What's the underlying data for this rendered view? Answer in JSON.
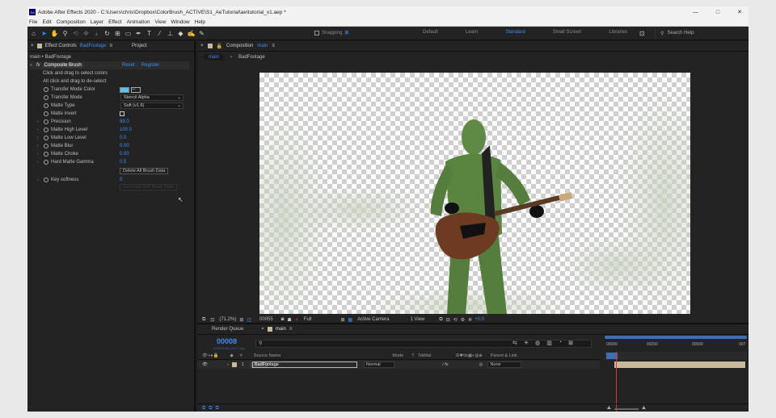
{
  "window": {
    "title": "Adobe After Effects 2020 - C:\\Users\\chris\\Dropbox\\ColorBrush_ACTIVE\\S1_AeTutorial\\ae\\tutorial_v1.aep *",
    "logo": "Ae",
    "minimize": "—",
    "maximize": "□",
    "close": "✕"
  },
  "menu": [
    "File",
    "Edit",
    "Composition",
    "Layer",
    "Effect",
    "Animation",
    "View",
    "Window",
    "Help"
  ],
  "toolbar": {
    "snapping": "Snapping",
    "workspaces": [
      "Default",
      "Learn",
      "Standard",
      "Small Screen",
      "Libraries"
    ],
    "active_workspace": "Standard",
    "search_placeholder": "Search Help"
  },
  "effect_controls": {
    "tab_label": "Effect Controls",
    "tab_layer": "BadFootage",
    "tab_project": "Project",
    "breadcrumb": "main • BadFootage",
    "effect_name": "Composite Brush",
    "reset": "Reset",
    "register": "Register",
    "hint1": "Click and drag to select colors",
    "hint2": "Alt click and drag to de-select",
    "properties": [
      {
        "label": "Transfer Mode Color",
        "value": ""
      },
      {
        "label": "Transfer Mode",
        "value": "Stencil Alpha"
      },
      {
        "label": "Matte Type",
        "value": "Soft (v1.6)"
      },
      {
        "label": "Matte Invert",
        "value": ""
      },
      {
        "label": "Precision",
        "value": "98.0"
      },
      {
        "label": "Matte High Level",
        "value": "100.0"
      },
      {
        "label": "Matte Low Level",
        "value": "0.0"
      },
      {
        "label": "Matte Blur",
        "value": "0.00"
      },
      {
        "label": "Matte Choke",
        "value": "0.00"
      },
      {
        "label": "Hard Matte Gamma",
        "value": "0.5"
      }
    ],
    "delete_button": "Delete All Brush Data",
    "key_softness_label": "Key softness",
    "key_softness_value": "0",
    "dim_button": "Generate Soft Matte Data"
  },
  "composition": {
    "panel_label": "Composition",
    "comp_name": "main",
    "tab": "main",
    "breadcrumb_layer": "BadFootage",
    "zoom": "(71.2%)",
    "timecode": "00055",
    "resolution": "Full",
    "camera": "Active Camera",
    "views": "1 View",
    "exposure": "+0.0"
  },
  "timeline": {
    "render_queue": "Render Queue",
    "comp_tab": "main",
    "timecode": "00008",
    "timecode_sub": "0:00:00:08 (29.97 fps)",
    "columns": {
      "source": "Source Name",
      "mode": "Mode",
      "trkmat": "TrkMat",
      "parent": "Parent & Link"
    },
    "layer": {
      "index": "1",
      "name": "BadFootage",
      "mode": "Normal",
      "parent": "None"
    },
    "ruler": [
      "00000",
      "00250",
      "00500",
      "007"
    ]
  },
  "colors": {
    "accent": "#3d8df5",
    "panel": "#232323",
    "bg": "#1d1d1d",
    "bar": "#c8b99a"
  }
}
